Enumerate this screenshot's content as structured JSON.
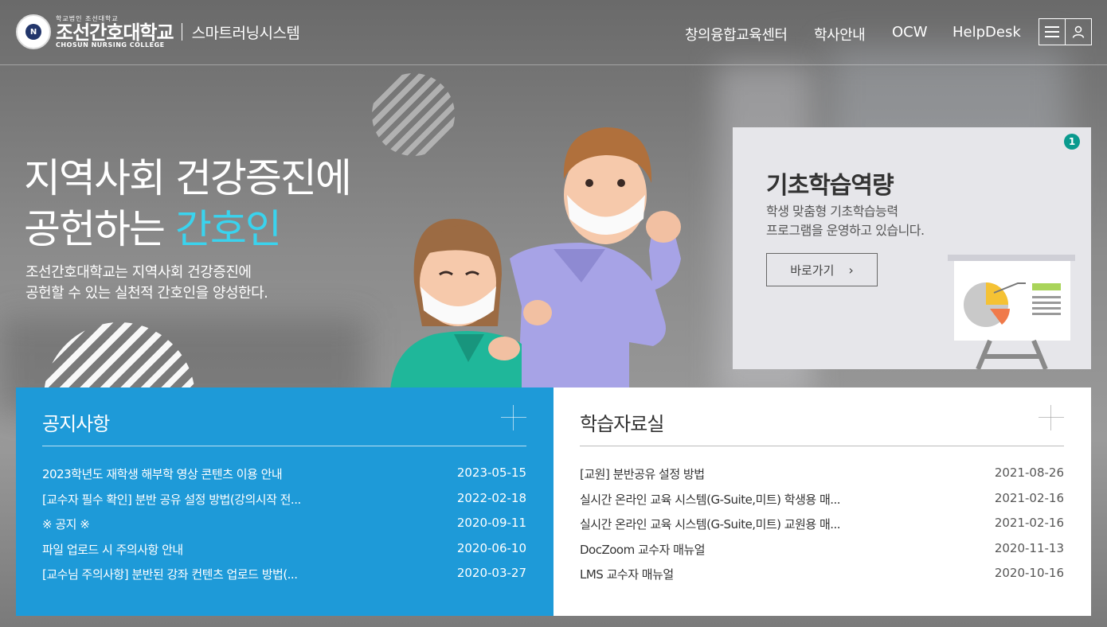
{
  "header": {
    "logo": {
      "small": "학교법인 조선대학교",
      "name": "조선간호대학교",
      "english": "CHOSUN NURSING COLLEGE",
      "emblem_letter": "N",
      "system": "스마트러닝시스템"
    },
    "nav": [
      "창의융합교육센터",
      "학사안내",
      "OCW",
      "HelpDesk"
    ],
    "icons": [
      "menu-icon",
      "user-icon"
    ]
  },
  "hero": {
    "title_line1": "지역사회 건강증진에",
    "title_line2_prefix": "공헌하는 ",
    "title_line2_accent": "간호인",
    "subtitle_line1": "조선간호대학교는 지역사회 건강증진에",
    "subtitle_line2": "공헌할 수 있는 실천적 간호인을 양성한다.",
    "accent_color": "#3ad3ee"
  },
  "promo": {
    "badge": "1",
    "title": "기초학습역량",
    "desc_line1": "학생 맞춤형 기초학습능력",
    "desc_line2": "프로그램을 운영하고 있습니다.",
    "button": "바로가기",
    "button_arrow": "›"
  },
  "notice": {
    "title": "공지사항",
    "color": "#1e9ad8",
    "items": [
      {
        "title": "2023학년도 재학생 해부학 영상 콘텐츠 이용 안내",
        "date": "2023-05-15"
      },
      {
        "title": "[교수자 필수 확인] 분반 공유 설정 방법(강의시작 전...",
        "date": "2022-02-18"
      },
      {
        "title": "※ 공지 ※",
        "date": "2020-09-11"
      },
      {
        "title": "파일 업로드 시 주의사항 안내",
        "date": "2020-06-10"
      },
      {
        "title": "[교수님 주의사항] 분반된 강좌 컨텐츠 업로드 방법(...",
        "date": "2020-03-27"
      }
    ]
  },
  "library": {
    "title": "학습자료실",
    "items": [
      {
        "title": "[교원] 분반공유 설정 방법",
        "date": "2021-08-26"
      },
      {
        "title": "실시간 온라인 교육 시스템(G-Suite,미트) 학생용 매...",
        "date": "2021-02-16"
      },
      {
        "title": "실시간 온라인 교육 시스템(G-Suite,미트) 교원용 매...",
        "date": "2021-02-16"
      },
      {
        "title": "DocZoom 교수자 매뉴얼",
        "date": "2020-11-13"
      },
      {
        "title": "LMS 교수자 매뉴얼",
        "date": "2020-10-16"
      }
    ]
  }
}
